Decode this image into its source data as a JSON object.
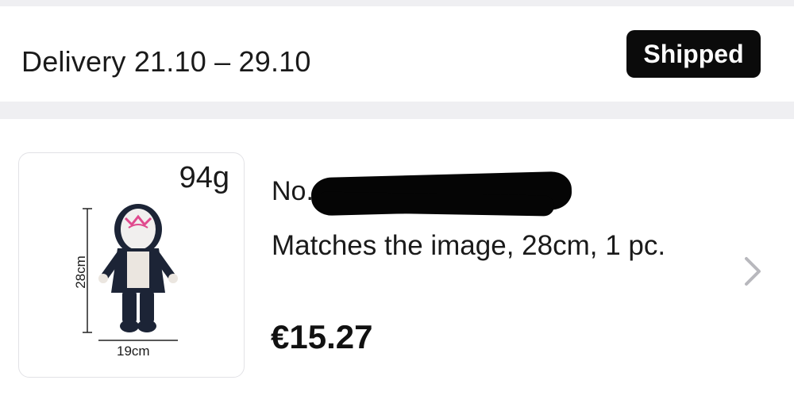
{
  "delivery": {
    "label": "Delivery 21.10 – 29.10",
    "status": "Shipped"
  },
  "item": {
    "image": {
      "weight": "94g",
      "height_label": "28cm",
      "width_label": "19cm"
    },
    "number_prefix": "No.",
    "variant": "Matches the image, 28cm, 1 pc.",
    "price": "€15.27"
  },
  "icons": {
    "chevron": "chevron-right-icon"
  },
  "colors": {
    "badge_bg": "#0b0b0b",
    "separator": "#efeff2"
  }
}
